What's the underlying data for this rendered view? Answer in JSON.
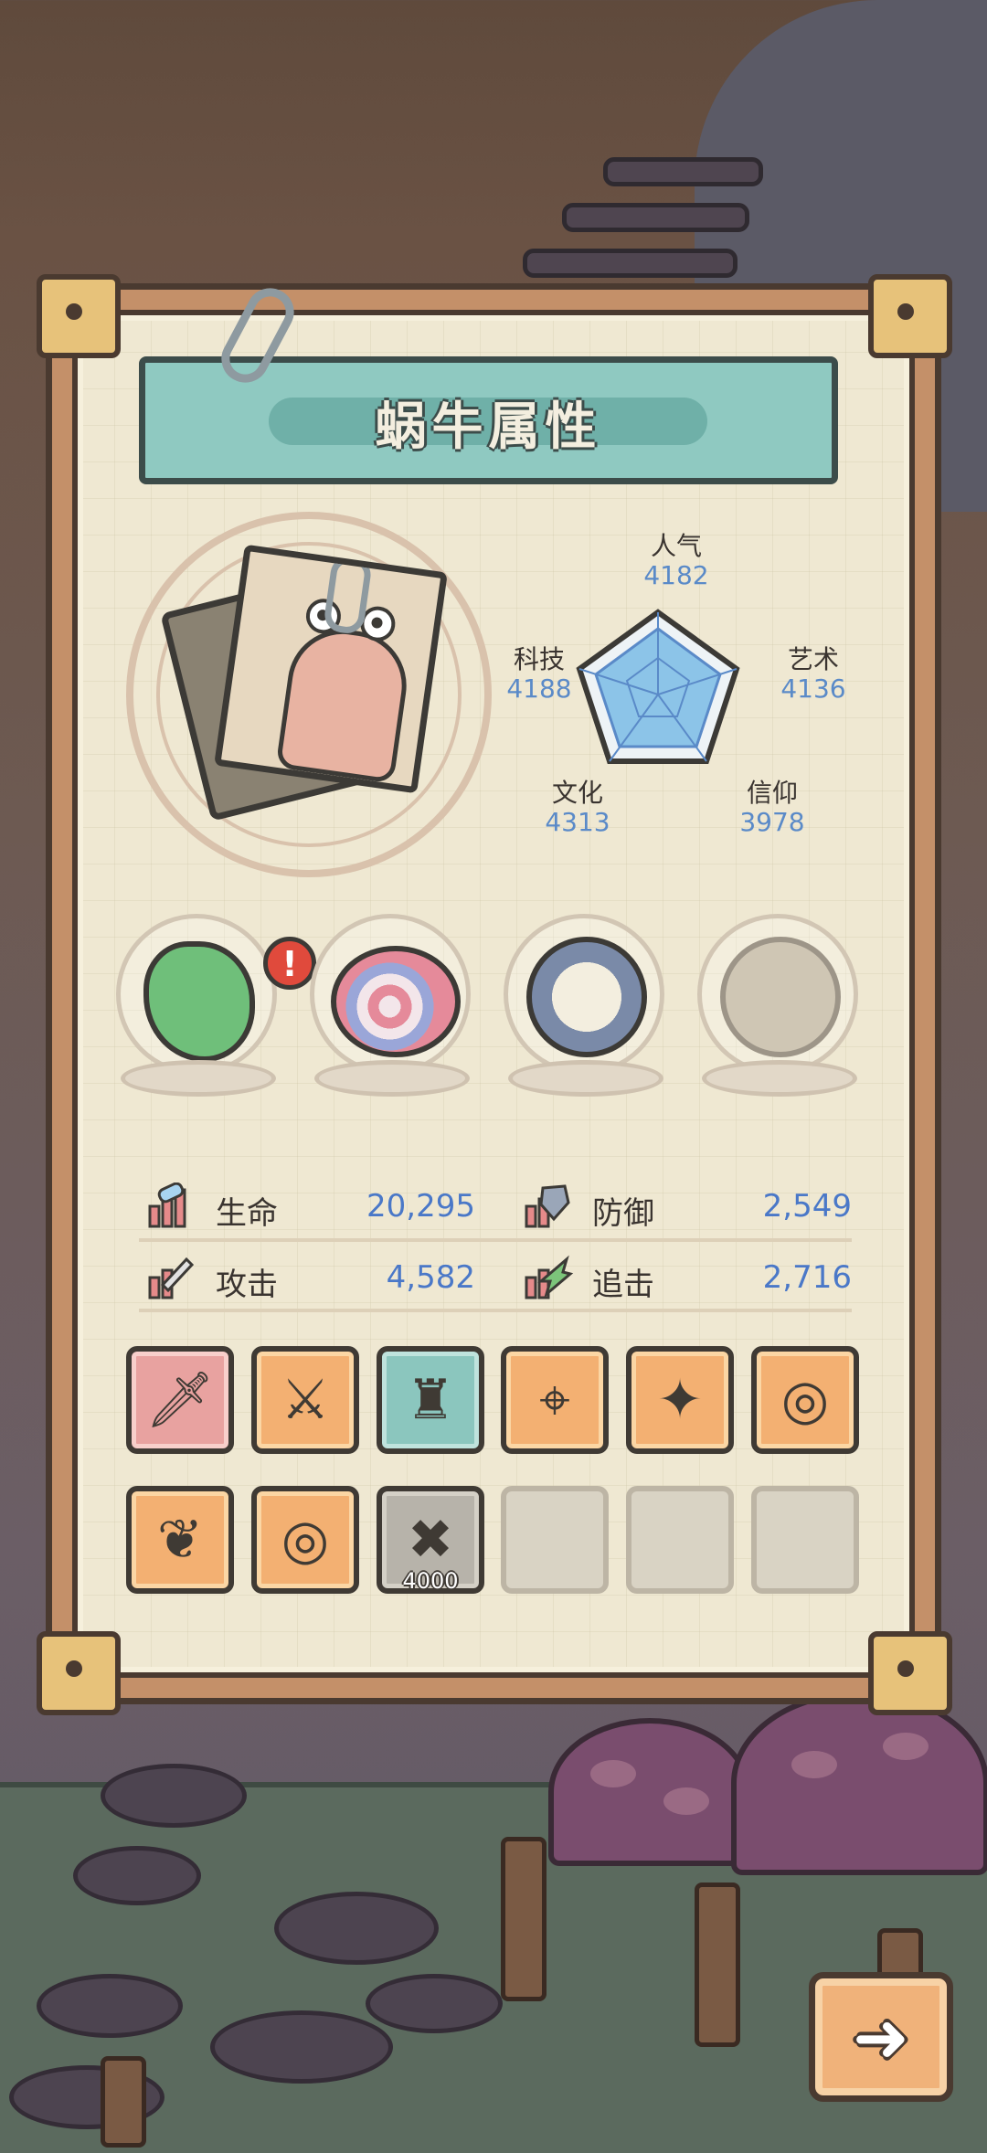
{
  "title": "蜗牛属性",
  "radar": {
    "popularity": {
      "label": "人气",
      "value": "4182"
    },
    "art": {
      "label": "艺术",
      "value": "4136"
    },
    "faith": {
      "label": "信仰",
      "value": "3978"
    },
    "culture": {
      "label": "文化",
      "value": "4313"
    },
    "tech": {
      "label": "科技",
      "value": "4188"
    }
  },
  "relics": [
    {
      "name": "green-dna-relic",
      "alert": "!"
    },
    {
      "name": "spiral-shell-relic"
    },
    {
      "name": "compass-relic"
    },
    {
      "name": "stone-relic-locked"
    }
  ],
  "stats": {
    "hp": {
      "label": "生命",
      "value": "20,295"
    },
    "defense": {
      "label": "防御",
      "value": "2,549"
    },
    "attack": {
      "label": "攻击",
      "value": "4,582"
    },
    "chase": {
      "label": "追击",
      "value": "2,716"
    }
  },
  "equipment": {
    "slots": [
      {
        "icon": "dagger-icon",
        "color": "pink"
      },
      {
        "icon": "sword-icon",
        "color": "orange"
      },
      {
        "icon": "armor-icon",
        "color": "teal"
      },
      {
        "icon": "scope-icon",
        "color": "orange"
      },
      {
        "icon": "amulet-icon",
        "color": "orange"
      },
      {
        "icon": "ring-icon",
        "color": "orange"
      },
      {
        "icon": "wing-icon",
        "color": "orange"
      },
      {
        "icon": "ring-icon",
        "color": "orange"
      },
      {
        "icon": "locked-slot-icon",
        "color": "gray",
        "cost": "4000"
      },
      {
        "icon": "",
        "color": "empty"
      },
      {
        "icon": "",
        "color": "empty"
      },
      {
        "icon": "",
        "color": "empty"
      }
    ]
  },
  "next_button": {
    "icon": "right-arrow-icon"
  },
  "colors": {
    "stat_value": "#4a78c8",
    "radar_fill": "#8cc4e8",
    "title_bg": "#8fc9c1",
    "slot_orange": "#f3b072"
  }
}
